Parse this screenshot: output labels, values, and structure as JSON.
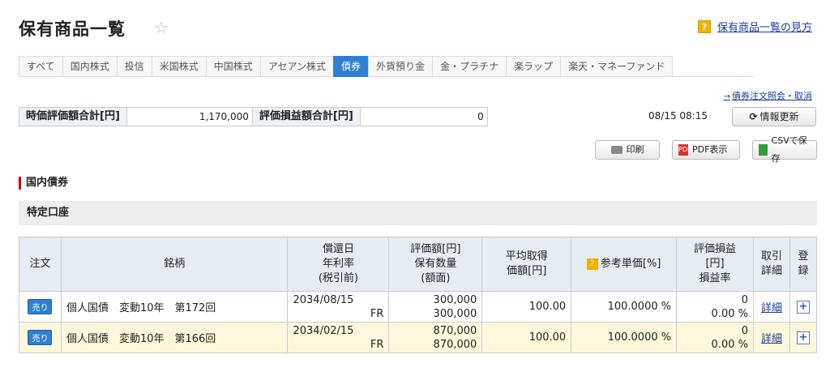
{
  "page": {
    "title": "保有商品一覧",
    "help_icon": "?",
    "help_link": "保有商品一覧の見方"
  },
  "tabs": [
    {
      "label": "すべて"
    },
    {
      "label": "国内株式"
    },
    {
      "label": "投信"
    },
    {
      "label": "米国株式"
    },
    {
      "label": "中国株式"
    },
    {
      "label": "アセアン株式"
    },
    {
      "label": "債券",
      "active": true
    },
    {
      "label": "外貨預り金"
    },
    {
      "label": "金・プラチナ"
    },
    {
      "label": "楽ラップ"
    },
    {
      "label": "楽天・マネーファンド"
    }
  ],
  "order_link": "債券注文照会・取消",
  "summary": {
    "market_value_label": "時価評価額合計[円]",
    "market_value": "1,170,000",
    "pnl_label": "評価損益額合計[円]",
    "pnl": "0"
  },
  "datetime": "08/15 08:15",
  "buttons": {
    "refresh": "情報更新",
    "print": "印刷",
    "pdf": "PDF表示",
    "pdf_icon_text": "PDF",
    "csv": "CSVで保存"
  },
  "section": {
    "title": "国内債券",
    "subsection": "特定口座"
  },
  "table": {
    "headers": {
      "order": "注文",
      "name": "銘柄",
      "maturity_1": "償還日",
      "maturity_2": "年利率",
      "maturity_3": "(税引前)",
      "value_1": "評価額[円]",
      "value_2": "保有数量",
      "value_3": "(額面)",
      "avg_1": "平均取得",
      "avg_2": "価額[円]",
      "ref_icon": "?",
      "ref": "参考単価[%]",
      "pnl_1": "評価損益",
      "pnl_2": "[円]",
      "pnl_3": "損益率",
      "detail_1": "取引",
      "detail_2": "詳細",
      "register": "登録"
    },
    "rows": [
      {
        "sell": "売り",
        "name": "個人国債　変動10年　第172回",
        "maturity": "2034/08/15",
        "rate": "FR",
        "value": "300,000",
        "quantity": "300,000",
        "avg_price": "100.00",
        "ref_price": "100.0000 %",
        "pnl": "0",
        "pnl_rate": "0.00 %",
        "detail": "詳細",
        "register": "+"
      },
      {
        "sell": "売り",
        "name": "個人国債　変動10年　第166回",
        "maturity": "2034/02/15",
        "rate": "FR",
        "value": "870,000",
        "quantity": "870,000",
        "avg_price": "100.00",
        "ref_price": "100.0000 %",
        "pnl": "0",
        "pnl_rate": "0.00 %",
        "detail": "詳細",
        "register": "+"
      }
    ]
  }
}
